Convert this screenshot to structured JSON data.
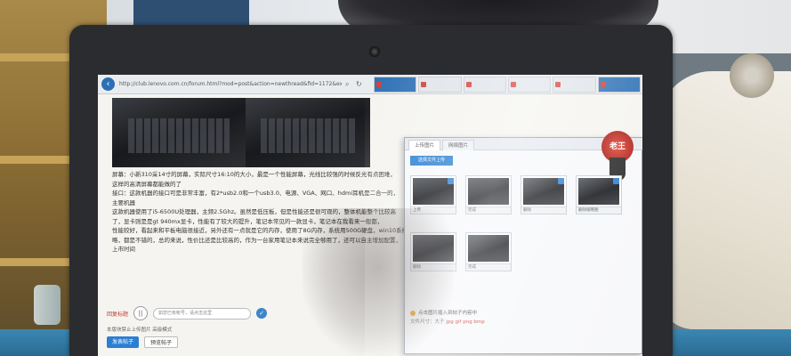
{
  "browser": {
    "url": "http://club.lenovo.com.cn/forum.html?mod=post&action=newthread&fid=1172&extra",
    "tabs": [
      "",
      "",
      "",
      "",
      "",
      ""
    ]
  },
  "article": {
    "lines": [
      "屏幕：小新310采14寸的屏幕，实际尺寸16:10的大小，最是一个性能屏幕，光线比较强的时候反光有点困难，",
      "这样的高清屏幕都能做的了",
      "接口：这款机器的接口可是非常丰富，有2*usb2.0和一个usb3.0、电源、VGA、网口、hdmi耳机是二合一的，",
      "主要机器",
      "这款机器使用了i5-6500U处理器，主频2.5Ghz。虽然是低压板，但是性能还是很可观的，整体机能整个比较高",
      "了，显卡则是是gt 940mx显卡，性能有了较大的提升，笔记本常见的一款显卡，笔记本在我看来一般都，",
      "性能较好，看起来和平板电脑很接近，另外还有一点就是它的内存，使用了8G内存，系统用500G硬盘，win10系统，",
      "略，都是不错的，总的来说，性价比还是比较高的，作为一台家用笔记本来说完全够用了，还可以自主增加配置，",
      "上市时间"
    ]
  },
  "reply": {
    "label": "回复标题",
    "pause_icon": "||",
    "input_placeholder": "如您已有帐号，请点击这里",
    "lock_icon": "✓",
    "tip": "本版块禁止上传图片   高级模式   ",
    "submit_label": "发表帖子",
    "preview_label": "预览帖子"
  },
  "dialog": {
    "tabs": [
      "上传图片",
      "网络图片"
    ],
    "upload_label": "选择文件上传",
    "badge_text": "老王",
    "thumbs": [
      {
        "label": "上传",
        "marked": true
      },
      {
        "label": "完成",
        "marked": false
      },
      {
        "label": "删除",
        "marked": true
      },
      {
        "label": "删除缩略图",
        "marked": true
      },
      {
        "label": "删除",
        "marked": false
      },
      {
        "label": "完成",
        "marked": false
      }
    ],
    "footer_line1": "点击图片插入到帖子内容中",
    "footer_line2_prefix": "文件尺寸：大于 ",
    "footer_line2_highlight": "jpg  gif  png  bmp"
  }
}
